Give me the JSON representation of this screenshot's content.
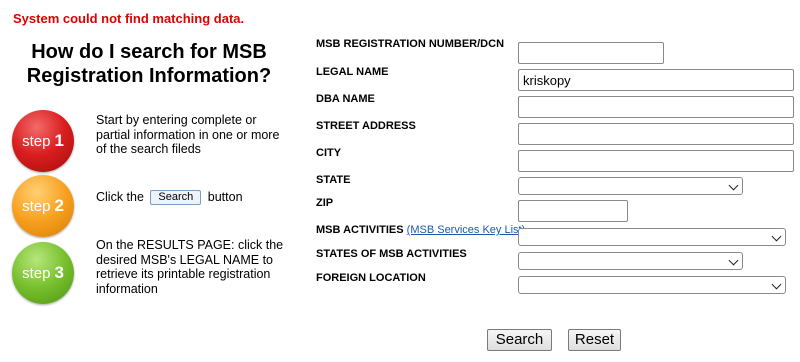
{
  "error": "System could not find matching data.",
  "help": {
    "title": "How do I search for MSB Registration Information?",
    "steps": [
      {
        "badge": "step",
        "num": "1",
        "text": "Start by entering complete or partial information in one or more of the search fileds",
        "color": "#d91e1e"
      },
      {
        "badge": "step",
        "num": "2",
        "text_before": "Click the",
        "button_label": "Search",
        "text_after": "button",
        "color": "#f7a01f"
      },
      {
        "badge": "step",
        "num": "3",
        "text": "On the RESULTS PAGE: click the desired MSB's LEGAL NAME to retrieve its printable registration information",
        "color": "#77bf2d"
      }
    ]
  },
  "form": {
    "registration_number": {
      "label": "MSB REGISTRATION NUMBER/DCN",
      "value": ""
    },
    "legal_name": {
      "label": "LEGAL NAME",
      "value": "kriskopy"
    },
    "dba_name": {
      "label": "DBA NAME",
      "value": ""
    },
    "street_address": {
      "label": "STREET ADDRESS",
      "value": ""
    },
    "city": {
      "label": "CITY",
      "value": ""
    },
    "state": {
      "label": "STATE",
      "value": ""
    },
    "zip": {
      "label": "ZIP",
      "value": ""
    },
    "msb_activities": {
      "label": "MSB ACTIVITIES",
      "link": "(MSB Services Key List)",
      "value": ""
    },
    "states_of_activities": {
      "label": "STATES OF MSB ACTIVITIES",
      "value": ""
    },
    "foreign_location": {
      "label": "FOREIGN LOCATION",
      "value": ""
    }
  },
  "buttons": {
    "search": "Search",
    "reset": "Reset"
  },
  "icons": {
    "dropdown": "chevron-down-icon"
  }
}
